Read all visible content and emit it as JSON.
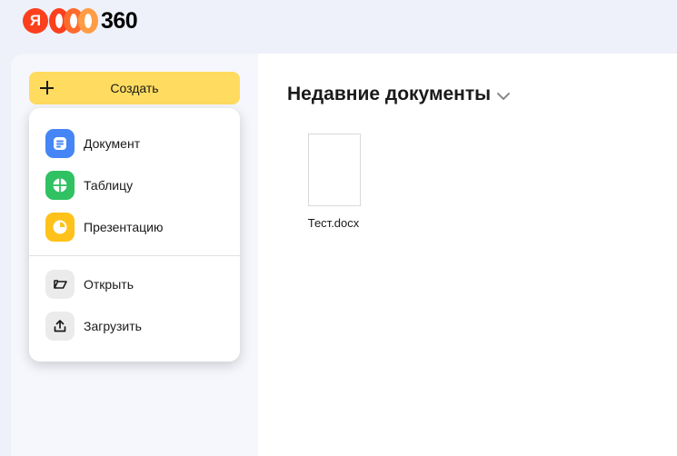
{
  "logo": {
    "ya": "Я",
    "text": "360"
  },
  "sidebar": {
    "create_label": "Создать",
    "menu": {
      "items": [
        {
          "label": "Документ",
          "icon": "document-icon",
          "color": "#4585f5"
        },
        {
          "label": "Таблицу",
          "icon": "spreadsheet-icon",
          "color": "#30c162"
        },
        {
          "label": "Презентацию",
          "icon": "presentation-icon",
          "color": "#ffc21a"
        },
        {
          "label": "Открыть",
          "icon": "open-icon",
          "color": "#ebebeb"
        },
        {
          "label": "Загрузить",
          "icon": "upload-icon",
          "color": "#ebebeb"
        }
      ]
    }
  },
  "main": {
    "title": "Недавние документы",
    "files": [
      {
        "name": "Тест.docx"
      }
    ]
  },
  "colors": {
    "accent": "#ffdc60",
    "brand": "#fc3f1d"
  }
}
